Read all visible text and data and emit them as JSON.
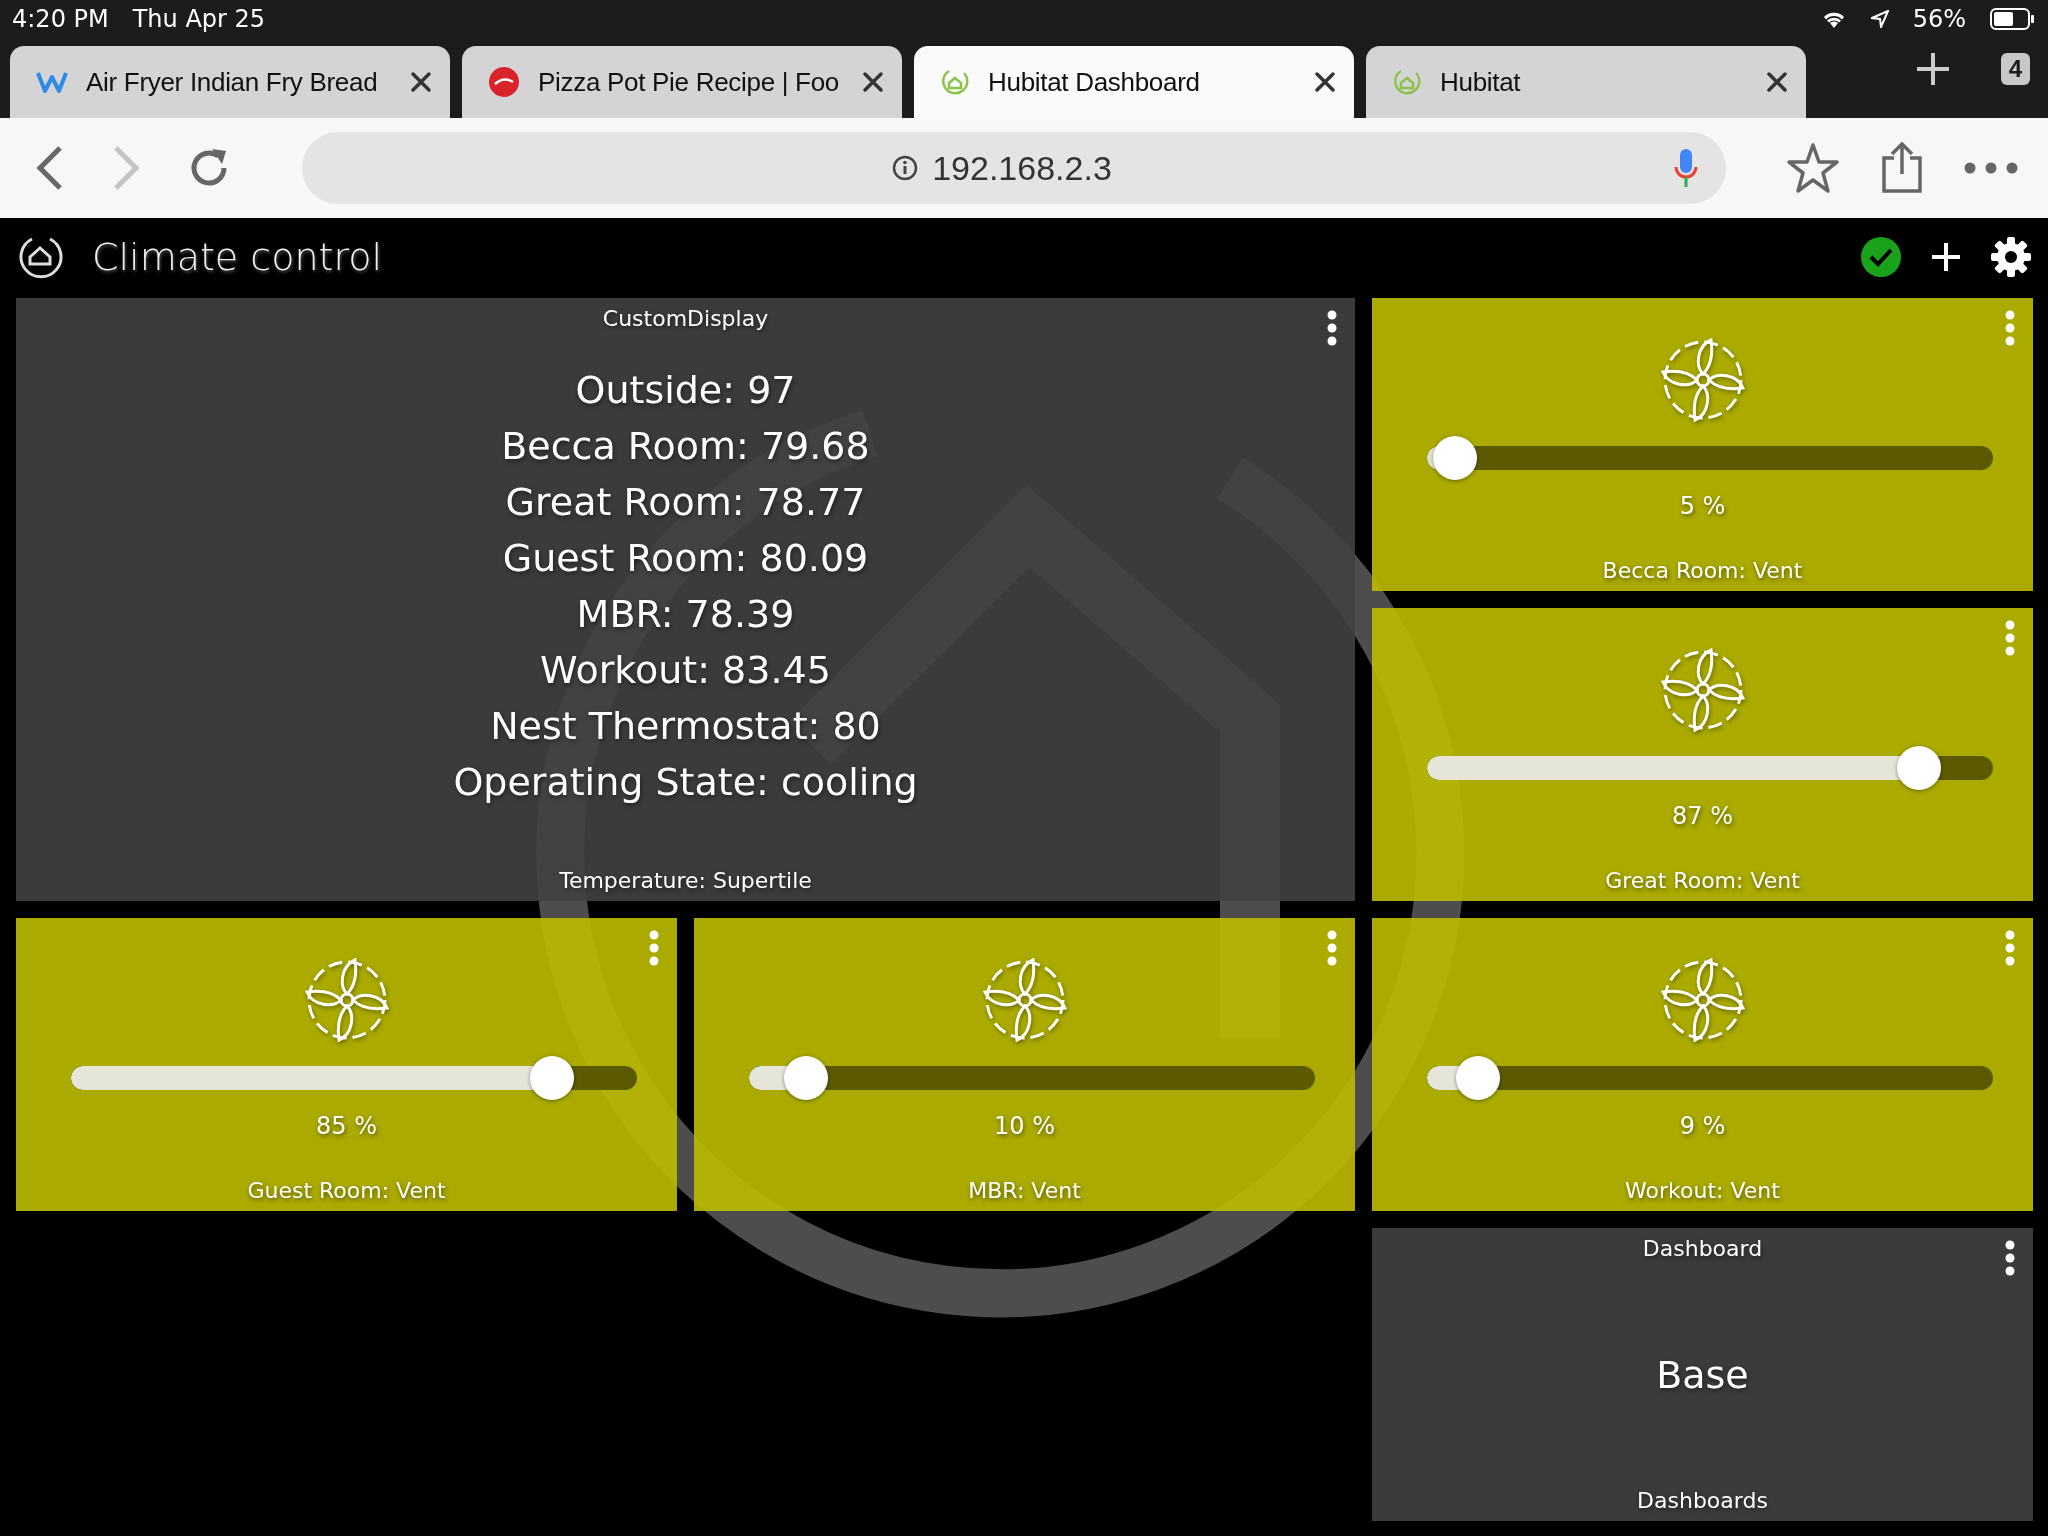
{
  "status_bar": {
    "time": "4:20 PM",
    "date": "Thu Apr 25",
    "battery": "56%"
  },
  "tabs": [
    {
      "kind": "w-logo",
      "title": "Air Fryer Indian Fry Bread",
      "selected": false
    },
    {
      "kind": "food-logo",
      "title": "Pizza Pot Pie Recipe | Foo",
      "selected": false
    },
    {
      "kind": "house-logo",
      "title": "Hubitat Dashboard",
      "selected": true
    },
    {
      "kind": "house-logo",
      "title": "Hubitat",
      "selected": false
    }
  ],
  "tab_count": "4",
  "toolbar": {
    "back": {
      "disabled": false
    },
    "forward": {
      "disabled": true
    },
    "address": "192.168.2.3"
  },
  "dashboard": {
    "title": "Climate control",
    "connected": true,
    "tiles": [
      {
        "kind": "custom",
        "title": "CustomDisplay",
        "lines": [
          "Outside: 97",
          "Becca Room: 79.68",
          "Great Room: 78.77",
          "Guest Room: 80.09",
          "MBR: 78.39",
          "Workout: 83.45",
          "Nest Thermostat: 80",
          "Operating State: cooling"
        ],
        "footer": "Temperature: Supertile"
      },
      {
        "kind": "vent",
        "name": "Becca Room: Vent",
        "level": 0.05,
        "reading": "5 %"
      },
      {
        "kind": "vent",
        "name": "Great Room: Vent",
        "level": 0.87,
        "reading": "87 %"
      },
      {
        "kind": "vent",
        "name": "Guest Room: Vent",
        "level": 0.85,
        "reading": "85 %"
      },
      {
        "kind": "vent",
        "name": "MBR: Vent",
        "level": 0.1,
        "reading": "10 %"
      },
      {
        "kind": "vent",
        "name": "Workout: Vent",
        "level": 0.09,
        "reading": "9 %"
      },
      {
        "kind": "link",
        "title": "Dashboard",
        "value": "Base",
        "footer": "Dashboards"
      }
    ]
  }
}
